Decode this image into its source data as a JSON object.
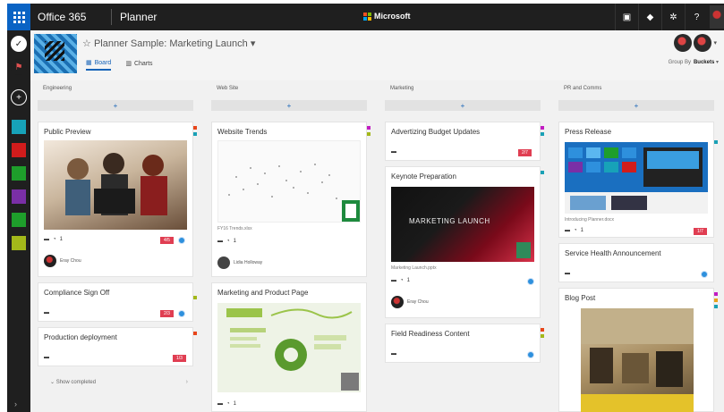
{
  "topbar": {
    "brand": "Office 365",
    "app": "Planner",
    "company": "Microsoft",
    "icons": [
      "chat-icon",
      "bell-icon",
      "gear-icon",
      "help-icon"
    ]
  },
  "rail": {
    "icons": [
      "check-icon",
      "person-icon",
      "plus-icon"
    ],
    "plans": [
      {
        "color": "#17a2b8"
      },
      {
        "color": "#d11c1c"
      },
      {
        "color": "#1e9e2b"
      },
      {
        "color": "#7a2fa6"
      },
      {
        "color": "#1e9e2b"
      },
      {
        "color": "#a3b81a"
      }
    ]
  },
  "header": {
    "title": "Planner Sample: Marketing Launch",
    "tabs": [
      {
        "label": "Board"
      },
      {
        "label": "Charts"
      }
    ],
    "group_by_label": "Group By",
    "group_by_value": "Buckets"
  },
  "buckets": [
    {
      "name": "Engineering",
      "cards": [
        {
          "title": "Public Preview",
          "badge": "4/5",
          "comments": "1",
          "assignee": "Eray Chou"
        },
        {
          "title": "Compliance Sign Off",
          "badge": "2/3"
        },
        {
          "title": "Production deployment",
          "badge": "1/3"
        }
      ],
      "show_completed": "Show completed"
    },
    {
      "name": "Web Site",
      "cards": [
        {
          "title": "Website Trends",
          "caption": "FY16 Trends.xlsx",
          "comments": "1",
          "assignee": "Lidia Holloway"
        },
        {
          "title": "Marketing and Product Page",
          "comments": "1"
        }
      ]
    },
    {
      "name": "Marketing",
      "cards": [
        {
          "title": "Advertizing Budget Updates",
          "badge": "2/7"
        },
        {
          "title": "Keynote Preparation",
          "caption": "Marketing Launch.pptx",
          "comments": "1",
          "preview_text": "MARKETING LAUNCH",
          "assignee": "Eray Chou"
        },
        {
          "title": "Field Readiness Content"
        }
      ]
    },
    {
      "name": "PR and Comms",
      "cards": [
        {
          "title": "Press Release",
          "caption": "Introducing Planner.docx",
          "comments": "1",
          "badge": "1/7"
        },
        {
          "title": "Service Health Announcement"
        },
        {
          "title": "Blog Post"
        }
      ]
    }
  ],
  "colors": {
    "accent": "#1663b8",
    "badge": "#e03e52",
    "topbar": "#1f1f1f"
  }
}
